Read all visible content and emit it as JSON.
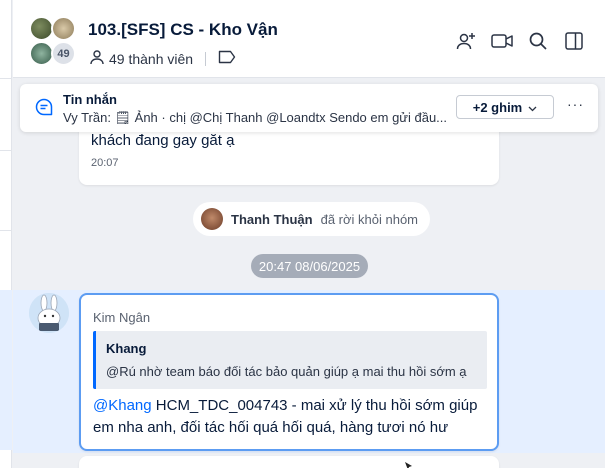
{
  "header": {
    "title": "103.[SFS] CS - Kho Vận",
    "avatar_overflow_count": "49",
    "member_count": "49 thành viên"
  },
  "pinned": {
    "title": "Tin nhắn",
    "preview": "Vy Trần: 🗒 Ảnh · chị @Chị Thanh @Loandtx Sendo em gửi đầu...",
    "more_label": "+2 ghim",
    "more_icon": "chevron-down-icon",
    "menu_label": "···"
  },
  "messages": [
    {
      "text": "khách đang gay găt ạ",
      "time": "20:07"
    },
    {
      "sender": "Kim Ngân",
      "quote": {
        "name": "Khang",
        "text": "@Rú nhờ team báo đối tác bảo quản giúp ạ mai thu hồi sớm ạ"
      },
      "mention": "@Khang",
      "text": " HCM_TDC_004743 - mai xử lý thu hồi sớm giúp em nha anh, đối tác hối quá hối quá, hàng tươi nó hư"
    }
  ],
  "system_notice": {
    "name": "Thanh Thuận",
    "action": "đã rời khỏi nhóm"
  },
  "date_separator": "20:47 08/06/2025",
  "colors": {
    "accent": "#0068ff",
    "highlight_row": "#e5efff",
    "selected_border": "#5c9cf2",
    "date_chip": "#a5acb8"
  }
}
